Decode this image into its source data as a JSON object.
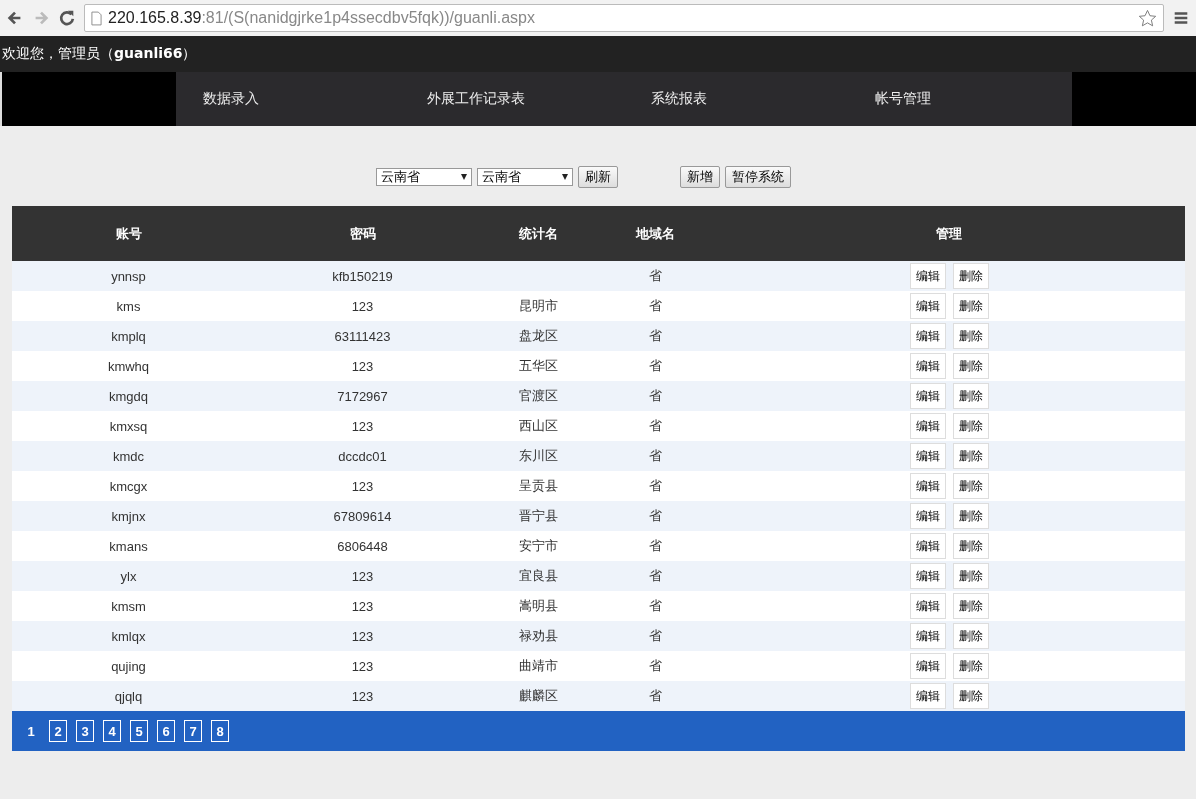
{
  "browser": {
    "url_host": "220.165.8.39",
    "url_path": ":81/(S(nanidgjrke1p4ssecdbv5fqk))/guanli.aspx"
  },
  "welcome": {
    "text": "欢迎您，管理员（",
    "user": "guanli66",
    "close": "）"
  },
  "nav": [
    "数据录入",
    "外展工作记录表",
    "系统报表",
    "帐号管理"
  ],
  "toolbar": {
    "selects": [
      "云南省",
      "云南省"
    ],
    "refresh": "刷新",
    "buttons": [
      "新增",
      "暂停系统"
    ]
  },
  "table": {
    "columns": [
      "账号",
      "密码",
      "统计名",
      "地域名",
      "管理"
    ],
    "rows": [
      {
        "account": "ynnsp",
        "password": "kfb150219",
        "stat": "",
        "region": "省",
        "edit": "编辑",
        "delete": "删除"
      },
      {
        "account": "kms",
        "password": "123",
        "stat": "昆明市",
        "region": "省",
        "edit": "编辑",
        "delete": "删除"
      },
      {
        "account": "kmplq",
        "password": "63111423",
        "stat": "盘龙区",
        "region": "省",
        "edit": "编辑",
        "delete": "删除"
      },
      {
        "account": "kmwhq",
        "password": "123",
        "stat": "五华区",
        "region": "省",
        "edit": "编辑",
        "delete": "删除"
      },
      {
        "account": "kmgdq",
        "password": "7172967",
        "stat": "官渡区",
        "region": "省",
        "edit": "编辑",
        "delete": "删除"
      },
      {
        "account": "kmxsq",
        "password": "123",
        "stat": "西山区",
        "region": "省",
        "edit": "编辑",
        "delete": "删除"
      },
      {
        "account": "kmdc",
        "password": "dccdc01",
        "stat": "东川区",
        "region": "省",
        "edit": "编辑",
        "delete": "删除"
      },
      {
        "account": "kmcgx",
        "password": "123",
        "stat": "呈贡县",
        "region": "省",
        "edit": "编辑",
        "delete": "删除"
      },
      {
        "account": "kmjnx",
        "password": "67809614",
        "stat": "晋宁县",
        "region": "省",
        "edit": "编辑",
        "delete": "删除"
      },
      {
        "account": "kmans",
        "password": "6806448",
        "stat": "安宁市",
        "region": "省",
        "edit": "编辑",
        "delete": "删除"
      },
      {
        "account": "ylx",
        "password": "123",
        "stat": "宜良县",
        "region": "省",
        "edit": "编辑",
        "delete": "删除"
      },
      {
        "account": "kmsm",
        "password": "123",
        "stat": "嵩明县",
        "region": "省",
        "edit": "编辑",
        "delete": "删除"
      },
      {
        "account": "kmlqx",
        "password": "123",
        "stat": "禄劝县",
        "region": "省",
        "edit": "编辑",
        "delete": "删除"
      },
      {
        "account": "qujing",
        "password": "123",
        "stat": "曲靖市",
        "region": "省",
        "edit": "编辑",
        "delete": "删除"
      },
      {
        "account": "qjqlq",
        "password": "123",
        "stat": "麒麟区",
        "region": "省",
        "edit": "编辑",
        "delete": "删除"
      }
    ]
  },
  "pager": [
    {
      "label": "1",
      "selected": true
    },
    {
      "label": "2",
      "selected": false
    },
    {
      "label": "3",
      "selected": false
    },
    {
      "label": "4",
      "selected": false
    },
    {
      "label": "5",
      "selected": false
    },
    {
      "label": "6",
      "selected": false
    },
    {
      "label": "7",
      "selected": false
    },
    {
      "label": "8",
      "selected": false
    }
  ]
}
